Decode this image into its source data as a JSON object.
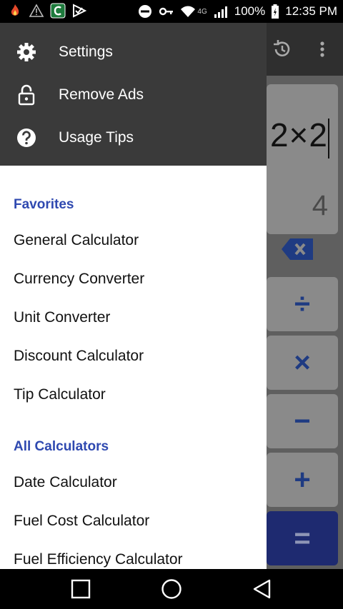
{
  "status_bar": {
    "battery_percent": "100%",
    "time": "12:35 PM",
    "network_label": "4G",
    "icons": [
      "fire-icon",
      "warning-icon",
      "app-c-icon",
      "check-app-icon",
      "dnd-icon",
      "key-icon",
      "wifi-icon",
      "signal-icon",
      "battery-icon"
    ]
  },
  "drawer": {
    "header_items": [
      {
        "label": "Settings",
        "icon": "gear-icon"
      },
      {
        "label": "Remove Ads",
        "icon": "lock-icon"
      },
      {
        "label": "Usage Tips",
        "icon": "help-icon"
      }
    ],
    "favorites_title": "Favorites",
    "favorites": [
      "General Calculator",
      "Currency Converter",
      "Unit Converter",
      "Discount Calculator",
      "Tip Calculator"
    ],
    "all_title": "All Calculators",
    "all": [
      "Date Calculator",
      "Fuel Cost Calculator",
      "Fuel Efficiency Calculator"
    ]
  },
  "calculator": {
    "expression": "2×2",
    "result": "4",
    "keys": [
      "÷",
      "×",
      "−",
      "+",
      "="
    ]
  },
  "colors": {
    "accent": "#2f49b0",
    "drawer_header": "#3a3a3a",
    "equals_key": "#1e2a70"
  },
  "navigation": {
    "buttons": [
      "recent-apps-icon",
      "home-icon",
      "back-icon"
    ]
  }
}
